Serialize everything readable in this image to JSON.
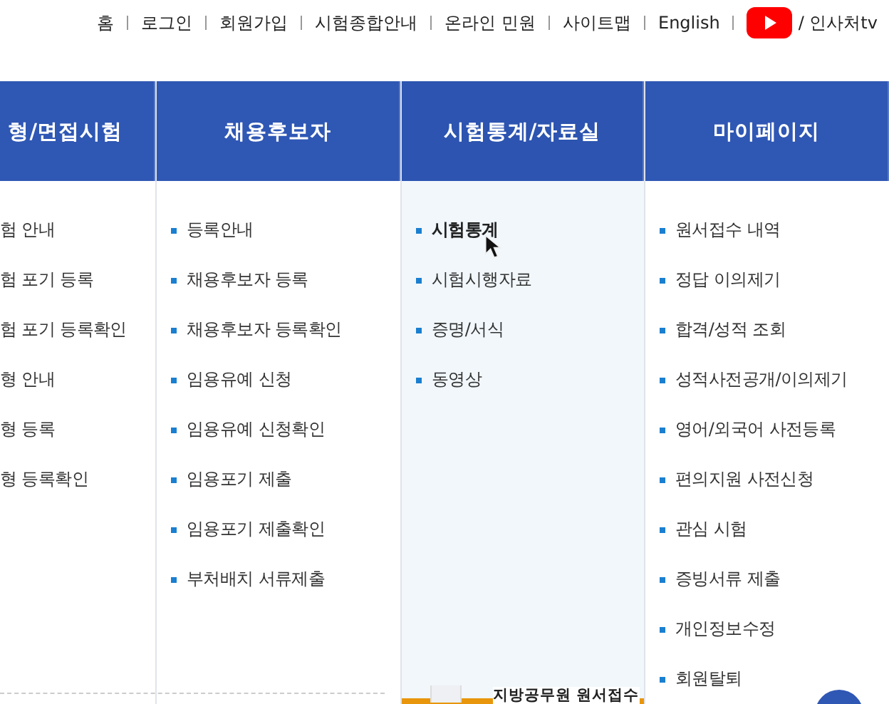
{
  "top_links": [
    {
      "label": "홈"
    },
    {
      "label": "로그인"
    },
    {
      "label": "회원가입"
    },
    {
      "label": "시험종합안내"
    },
    {
      "label": "온라인 민원"
    },
    {
      "label": "사이트맵"
    },
    {
      "label": "English"
    }
  ],
  "channel_link": {
    "label": "/ 인사처tv"
  },
  "menu_columns": [
    {
      "title": "형/면접시험",
      "selected": false,
      "items": [
        {
          "label": "험 안내",
          "hovered": false
        },
        {
          "label": "험 포기 등록",
          "hovered": false
        },
        {
          "label": "험 포기 등록확인",
          "hovered": false
        },
        {
          "label": "형 안내",
          "hovered": false
        },
        {
          "label": "형 등록",
          "hovered": false
        },
        {
          "label": "형 등록확인",
          "hovered": false
        }
      ]
    },
    {
      "title": "채용후보자",
      "selected": false,
      "items": [
        {
          "label": "등록안내",
          "hovered": false
        },
        {
          "label": "채용후보자 등록",
          "hovered": false
        },
        {
          "label": "채용후보자 등록확인",
          "hovered": false
        },
        {
          "label": "임용유예 신청",
          "hovered": false
        },
        {
          "label": "임용유예 신청확인",
          "hovered": false
        },
        {
          "label": "임용포기 제출",
          "hovered": false
        },
        {
          "label": "임용포기 제출확인",
          "hovered": false
        },
        {
          "label": "부처배치 서류제출",
          "hovered": false
        }
      ]
    },
    {
      "title": "시험통계/자료실",
      "selected": true,
      "items": [
        {
          "label": "시험통계",
          "hovered": true
        },
        {
          "label": "시험시행자료",
          "hovered": false
        },
        {
          "label": "증명/서식",
          "hovered": false
        },
        {
          "label": "동영상",
          "hovered": false
        }
      ]
    },
    {
      "title": "마이페이지",
      "selected": false,
      "items": [
        {
          "label": "원서접수 내역",
          "hovered": false
        },
        {
          "label": "정답 이의제기",
          "hovered": false
        },
        {
          "label": "합격/성적 조회",
          "hovered": false
        },
        {
          "label": "성적사전공개/이의제기",
          "hovered": false
        },
        {
          "label": "영어/외국어 사전등록",
          "hovered": false
        },
        {
          "label": "편의지원 사전신청",
          "hovered": false
        },
        {
          "label": "관심 시험",
          "hovered": false
        },
        {
          "label": "증빙서류 제출",
          "hovered": false
        },
        {
          "label": "개인정보수정",
          "hovered": false
        },
        {
          "label": "회원탈퇴",
          "hovered": false
        }
      ]
    }
  ],
  "below_heading": "지방공무원 원서접수"
}
